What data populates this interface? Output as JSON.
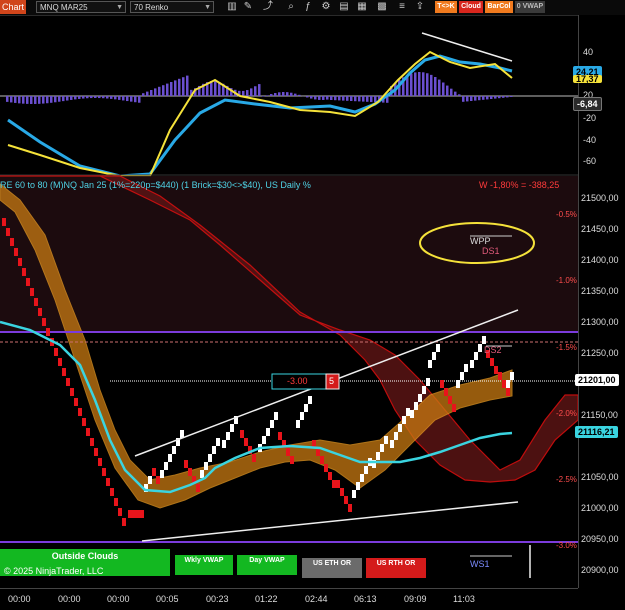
{
  "toolbar": {
    "chart_tab": "Chart",
    "instrument": "MNQ MAR25",
    "bar_type": "70 Renko",
    "buttons": [
      {
        "label": "T<>K",
        "color": "#f07a1e"
      },
      {
        "label": "Cloud",
        "color": "#d8261d"
      },
      {
        "label": "BarCol",
        "color": "#f07a1e"
      },
      {
        "label": "0 VWAP",
        "color": "#3a3a3a"
      }
    ]
  },
  "corner_button": "F",
  "oscillator": {
    "axis_ticks": [
      "40",
      "20",
      "-20",
      "-40",
      "-60"
    ],
    "tag_blue": "24,21",
    "tag_yellow": "17,37",
    "tag_hist": "-6,84"
  },
  "price_chart": {
    "title": "RE 60 to 80 (M)NQ Jan 25 (1%=220p=$440) (1 Brick=$30<>$40), US Daily %",
    "week_label": "W -1,80% = -388,25",
    "axis_ticks": [
      "21500,00",
      "21450,00",
      "21400,00",
      "21350,00",
      "21300,00",
      "21250,00",
      "21200,00",
      "21150,00",
      "21100,00",
      "21050,00",
      "21000,00",
      "20950,00",
      "20900,00"
    ],
    "pct_levels": [
      "-0.5%",
      "-1.0%",
      "-1.5%",
      "-2.0%",
      "-2.5%",
      "-3.0%"
    ],
    "current_price": "21201,00",
    "cyan_price": "21116,21",
    "order_qty": "-3.00",
    "order_count": "5",
    "wpp_label": "WPP",
    "ds1_label": "DS1",
    "ds2_label": "DS2",
    "ws1_label": "WS1"
  },
  "bottom_buttons": {
    "outside_clouds": "Outside Clouds",
    "copyright": "© 2025 NinjaTrader, LLC",
    "wkly_vwap": "Wkly VWAP",
    "day_vwap": "Day VWAP",
    "us_eth_or": "US ETH OR",
    "us_rth_or": "US RTH OR"
  },
  "time_axis": [
    "00:00",
    "00:00",
    "00:00",
    "00:05",
    "00:23",
    "01:22",
    "02:44",
    "06:13",
    "09:09",
    "11:03"
  ],
  "colors": {
    "brick_up": "#ffffff",
    "brick_down": "#e8141b",
    "cloud_orange": "#c97a12",
    "cloud_red": "#5a1414",
    "cyan_line": "#3ad4e0",
    "osc_blue": "#29a9e6",
    "osc_yellow": "#f5e23a",
    "histogram": "#6a4fd0",
    "level_purple": "#7b3bdc"
  }
}
